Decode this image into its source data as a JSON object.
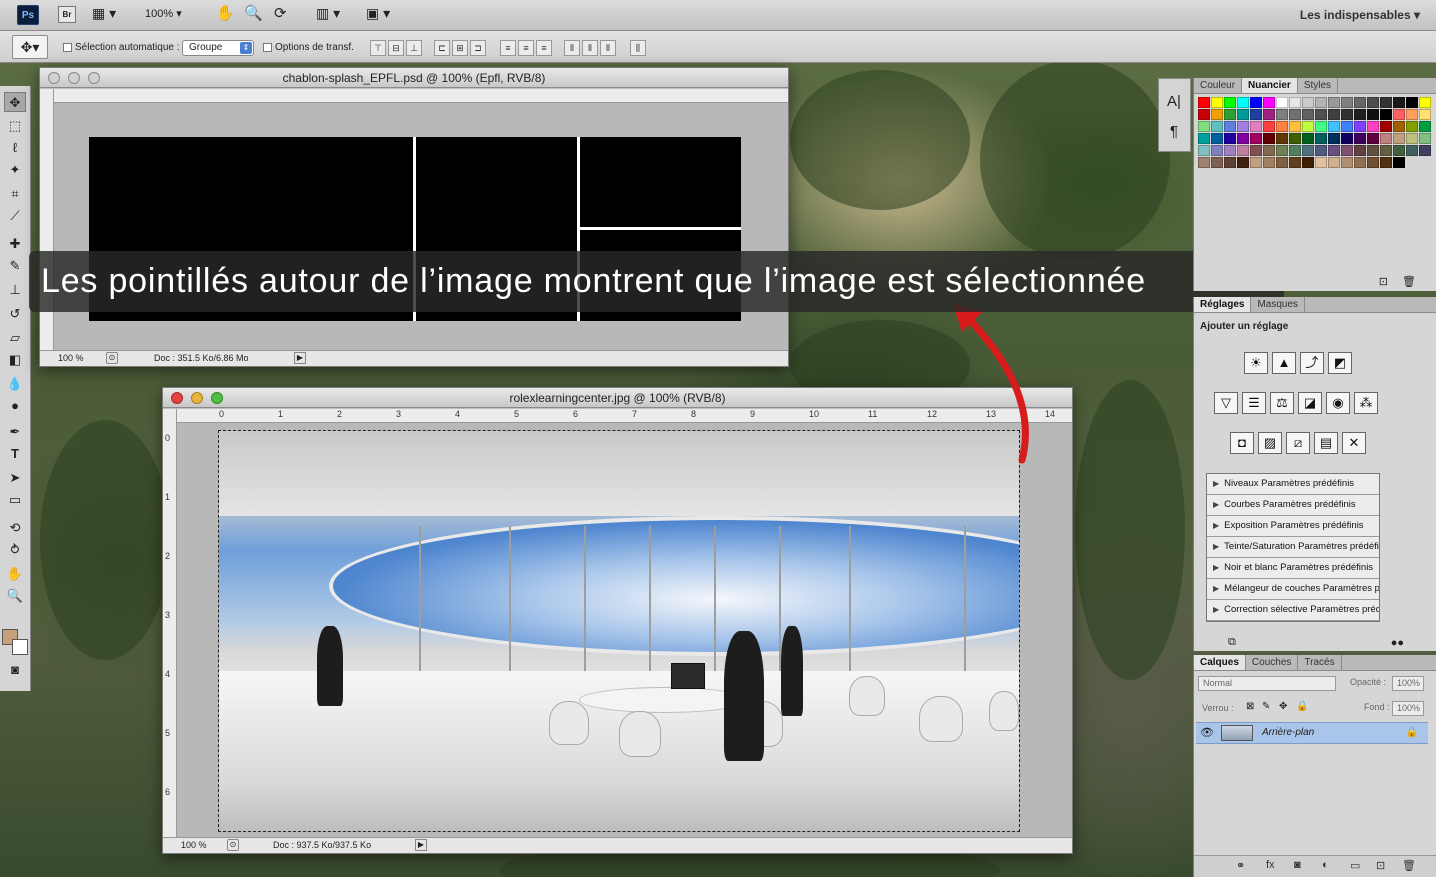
{
  "appbar": {
    "ps_logo": "Ps",
    "br_logo": "Br",
    "zoom": "100%",
    "workspace": "Les indispensables ▾"
  },
  "options": {
    "auto_select_label": "Sélection automatique :",
    "auto_select_value": "Groupe",
    "transform_label": "Options de transf."
  },
  "splash_doc": {
    "title": "chablon-splash_EPFL.psd @ 100% (Epfl, RVB/8)",
    "zoom": "100 %",
    "doc": "Doc : 351.5 Ko/6.86 Mo"
  },
  "photo_doc": {
    "title": "rolexlearningcenter.jpg @ 100% (RVB/8)",
    "zoom": "100 %",
    "doc": "Doc : 937.5 Ko/937.5 Ko",
    "ruler_h": [
      "0",
      "1",
      "2",
      "3",
      "4",
      "5",
      "6",
      "7",
      "8",
      "9",
      "10",
      "11",
      "12",
      "13",
      "14"
    ],
    "ruler_v": [
      "0",
      "1",
      "2",
      "3",
      "4",
      "5",
      "6"
    ]
  },
  "caption": "Les pointillés autour de l’image montrent que l’image est sélectionnée",
  "color_panel": {
    "tabs": [
      "Couleur",
      "Nuancier",
      "Styles"
    ]
  },
  "adjust_panel": {
    "tabs": [
      "Réglages",
      "Masques"
    ],
    "title": "Ajouter un réglage",
    "presets": [
      "Niveaux Paramètres prédéfinis",
      "Courbes Paramètres prédéfinis",
      "Exposition Paramètres prédéfinis",
      "Teinte/Saturation Paramètres prédéfinis",
      "Noir et blanc Paramètres prédéfinis",
      "Mélangeur de couches Paramètres préd...",
      "Correction sélective Paramètres prédéfi..."
    ]
  },
  "layers_panel": {
    "tabs": [
      "Calques",
      "Couches",
      "Tracés"
    ],
    "blend_mode": "Normal",
    "opacity_label": "Opacité :",
    "opacity_value": "100%",
    "lock_label": "Verrou :",
    "fill_label": "Fond :",
    "fill_value": "100%",
    "layer_name": "Arrière-plan"
  },
  "colors": {
    "accent": "#4a7fd1",
    "selected_layer": "#a9c5ea",
    "arrow": "#d81c1c"
  }
}
